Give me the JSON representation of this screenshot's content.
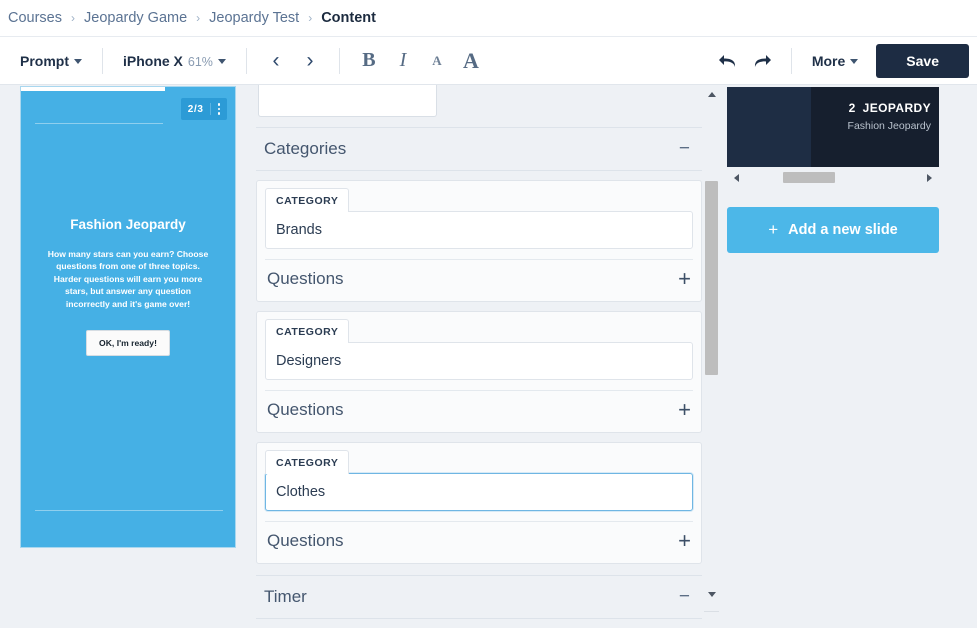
{
  "breadcrumb": {
    "items": [
      {
        "label": "Courses",
        "active": false
      },
      {
        "label": "Jeopardy Game",
        "active": false
      },
      {
        "label": "Jeopardy Test",
        "active": false
      },
      {
        "label": "Content",
        "active": true
      }
    ],
    "separator": "›"
  },
  "toolbar": {
    "prompt_label": "Prompt",
    "device_label": "iPhone X",
    "zoom_label": "61%",
    "prev_icon": "‹",
    "next_icon": "›",
    "bold_label": "B",
    "italic_label": "I",
    "font_small_label": "A",
    "font_large_label": "A",
    "undo_icon": "↶",
    "redo_icon": "↷",
    "more_label": "More",
    "save_label": "Save",
    "save_bg": "#1d2c43"
  },
  "preview": {
    "page_indicator": "2/3",
    "title": "Fashion Jeopardy",
    "description": "How many stars can you earn? Choose questions from one of three topics. Harder questions will earn you more stars, but answer any question incorrectly and it's game over!",
    "cta_label": "OK, I'm ready!",
    "background": "#45b0e5"
  },
  "editor": {
    "top_field_value": "",
    "sections": [
      {
        "title": "Categories",
        "toggle": "−"
      },
      {
        "title": "Timer",
        "toggle": "−"
      }
    ],
    "category_tab_label": "CATEGORY",
    "questions_label": "Questions",
    "add_question_icon": "+",
    "categories": [
      {
        "tab": "CATEGORY",
        "value": "Brands",
        "focused": false
      },
      {
        "tab": "CATEGORY",
        "value": "Designers",
        "focused": false
      },
      {
        "tab": "CATEGORY",
        "value": "Clothes",
        "focused": true
      }
    ]
  },
  "slides": {
    "thumbnail": {
      "number": "2",
      "title": "JEOPARDY",
      "subtitle": "Fashion Jeopardy"
    },
    "add_slide_label": "Add a new slide",
    "add_slide_plus": "+",
    "add_slide_bg": "#4cb7e8",
    "scroll_left_icon": "◀",
    "scroll_right_icon": "▶"
  }
}
